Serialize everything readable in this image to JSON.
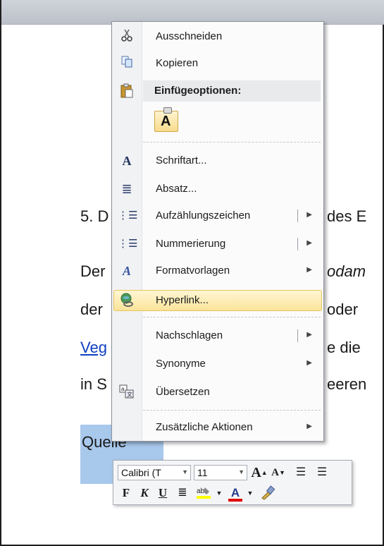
{
  "document": {
    "line1_a": "5. D",
    "line1_b": "des E",
    "line2_a": "Der",
    "line2_b": "odam",
    "line3_a": "der",
    "line3_b": "oder",
    "line4_link": "Veg",
    "line4_b": "e die",
    "line5_a": "in S",
    "line5_b": "eeren",
    "selected_text": "Quelle"
  },
  "context_menu": {
    "items": [
      {
        "label": "Ausschneiden",
        "icon": "scissors-icon"
      },
      {
        "label": "Kopieren",
        "icon": "copy-icon"
      },
      {
        "label": "Schriftart...",
        "icon": "font-icon",
        "glyph": "A"
      },
      {
        "label": "Absatz...",
        "icon": "paragraph-icon",
        "glyph": "≣"
      },
      {
        "label": "Aufzählungszeichen",
        "icon": "bullets-icon",
        "glyph": "⋮☰"
      },
      {
        "label": "Nummerierung",
        "icon": "numbering-icon",
        "glyph": "⋮☰"
      },
      {
        "label": "Formatvorlagen",
        "icon": "styles-icon",
        "glyph": "A"
      },
      {
        "label": "Hyperlink...",
        "icon": "hyperlink-globe-icon"
      },
      {
        "label": "Nachschlagen"
      },
      {
        "label": "Synonyme"
      },
      {
        "label": "Übersetzen",
        "icon": "translate-icon"
      },
      {
        "label": "Zusätzliche Aktionen"
      }
    ],
    "paste_header": "Einfügeoptionen:",
    "paste_option": "A"
  },
  "mini_toolbar": {
    "font_name": "Calibri (T",
    "font_size": "11",
    "grow_font": "A",
    "shrink_font": "A",
    "bold": "F",
    "italic": "K",
    "underline": "U",
    "font_color_letter": "A"
  },
  "colors": {
    "highlight_yellow": "#ffff00",
    "font_color_red": "#e00000",
    "selection_blue": "#a8c8ec",
    "link_blue": "#1040c0"
  }
}
